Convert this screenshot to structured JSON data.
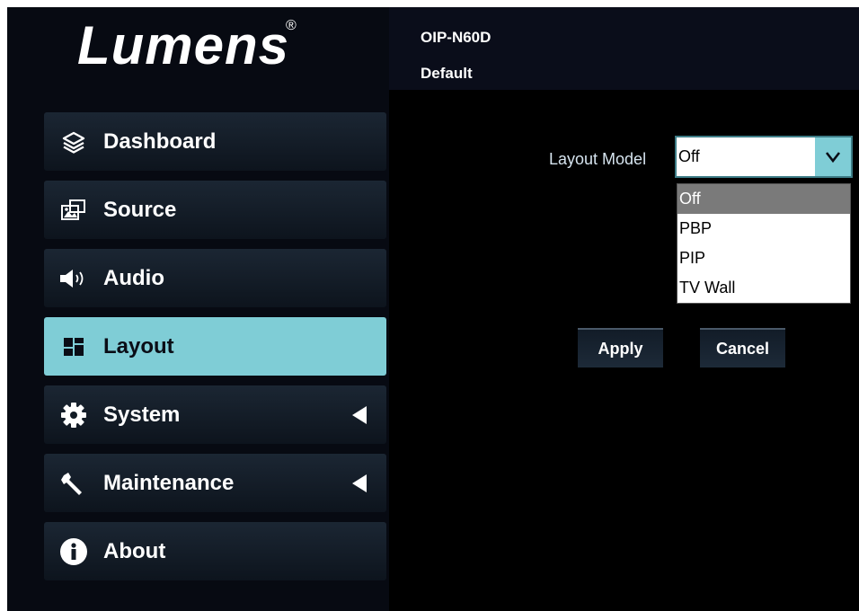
{
  "brand": {
    "logo_text": "Lumens",
    "registered_mark": "®"
  },
  "header": {
    "model": "OIP-N60D",
    "preset": "Default"
  },
  "sidebar": {
    "items": [
      {
        "label": "Dashboard",
        "icon": "layers-icon",
        "active": false,
        "has_submenu": false
      },
      {
        "label": "Source",
        "icon": "image-source-icon",
        "active": false,
        "has_submenu": false
      },
      {
        "label": "Audio",
        "icon": "speaker-icon",
        "active": false,
        "has_submenu": false
      },
      {
        "label": "Layout",
        "icon": "layout-grid-icon",
        "active": true,
        "has_submenu": false
      },
      {
        "label": "System",
        "icon": "gear-icon",
        "active": false,
        "has_submenu": true
      },
      {
        "label": "Maintenance",
        "icon": "wrench-icon",
        "active": false,
        "has_submenu": true
      },
      {
        "label": "About",
        "icon": "info-icon",
        "active": false,
        "has_submenu": false
      }
    ]
  },
  "main": {
    "layout_model_label": "Layout Model",
    "layout_model_value": "Off",
    "layout_model_options": [
      "Off",
      "PBP",
      "PIP",
      "TV Wall"
    ],
    "apply_label": "Apply",
    "cancel_label": "Cancel"
  },
  "colors": {
    "background": "#0a0d16",
    "accent": "#7fcdd6",
    "panel": "#000000"
  }
}
